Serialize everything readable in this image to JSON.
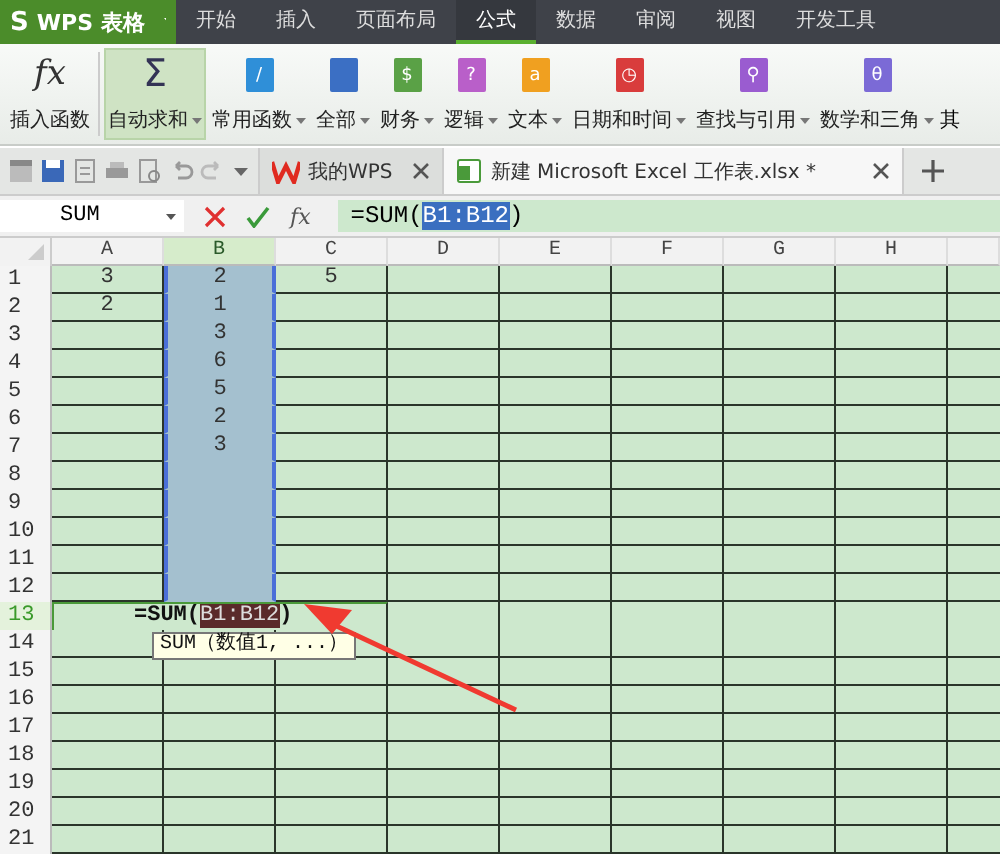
{
  "app_menu": {
    "label": "WPS 表格",
    "logo": "S"
  },
  "menu_tabs": [
    {
      "label": "开始",
      "selected": false
    },
    {
      "label": "插入",
      "selected": false
    },
    {
      "label": "页面布局",
      "selected": false
    },
    {
      "label": "公式",
      "selected": true
    },
    {
      "label": "数据",
      "selected": false
    },
    {
      "label": "审阅",
      "selected": false
    },
    {
      "label": "视图",
      "selected": false
    },
    {
      "label": "开发工具",
      "selected": false
    }
  ],
  "ribbon": [
    {
      "label": "插入函数",
      "kind": "fx",
      "glyph": "fx",
      "dropdown": false,
      "selected": false
    },
    {
      "label": "自动求和",
      "kind": "sigma",
      "glyph": "Σ",
      "dropdown": true,
      "selected": true
    },
    {
      "label": "常用函数",
      "kind": "book",
      "glyph": "/",
      "color": "#2f8fd8",
      "dropdown": true,
      "selected": false
    },
    {
      "label": "全部",
      "kind": "book",
      "color": "#3b6fc4",
      "dropdown": true,
      "selected": false
    },
    {
      "label": "财务",
      "kind": "book",
      "glyph": "$",
      "color": "#5aa146",
      "dropdown": true,
      "selected": false
    },
    {
      "label": "逻辑",
      "kind": "book",
      "glyph": "?",
      "color": "#b95fc9",
      "dropdown": true,
      "selected": false
    },
    {
      "label": "文本",
      "kind": "book",
      "glyph": "a",
      "color": "#f0a020",
      "dropdown": true,
      "selected": false
    },
    {
      "label": "日期和时间",
      "kind": "book",
      "glyph": "◷",
      "color": "#d93c3c",
      "dropdown": true,
      "selected": false
    },
    {
      "label": "查找与引用",
      "kind": "book",
      "glyph": "⚲",
      "color": "#9a5cd0",
      "dropdown": true,
      "selected": false
    },
    {
      "label": "数学和三角",
      "kind": "book",
      "glyph": "θ",
      "color": "#7b6ad6",
      "dropdown": true,
      "selected": false
    },
    {
      "label": "其",
      "kind": "text"
    }
  ],
  "doc_tabs": [
    {
      "label": "我的WPS",
      "kind": "wps",
      "selected": false
    },
    {
      "label": "新建 Microsoft Excel 工作表.xlsx *",
      "kind": "sheet",
      "selected": true
    }
  ],
  "formula_bar": {
    "name_box": "SUM",
    "fx": "fx",
    "formula": "=SUM(",
    "reference": "B1:B12",
    "closing": ")"
  },
  "columns": [
    {
      "label": "A",
      "selected": false
    },
    {
      "label": "B",
      "selected": true
    },
    {
      "label": "C",
      "selected": false
    },
    {
      "label": "D",
      "selected": false
    },
    {
      "label": "E",
      "selected": false
    },
    {
      "label": "F",
      "selected": false
    },
    {
      "label": "G",
      "selected": false
    },
    {
      "label": "H",
      "selected": false
    }
  ],
  "rows": [
    {
      "label": "1",
      "selected": false,
      "in_range": true,
      "cells": [
        "3",
        "2",
        "5"
      ]
    },
    {
      "label": "2",
      "selected": false,
      "in_range": true,
      "cells": [
        "2",
        "1"
      ]
    },
    {
      "label": "3",
      "selected": false,
      "in_range": true,
      "cells": [
        null,
        "3"
      ]
    },
    {
      "label": "4",
      "selected": false,
      "in_range": true,
      "cells": [
        null,
        "6"
      ]
    },
    {
      "label": "5",
      "selected": false,
      "in_range": true,
      "cells": [
        null,
        "5"
      ]
    },
    {
      "label": "6",
      "selected": false,
      "in_range": true,
      "cells": [
        null,
        "2"
      ]
    },
    {
      "label": "7",
      "selected": false,
      "in_range": true,
      "cells": [
        null,
        "3"
      ]
    },
    {
      "label": "8",
      "selected": false,
      "in_range": true
    },
    {
      "label": "9",
      "selected": false,
      "in_range": true
    },
    {
      "label": "10",
      "selected": false,
      "in_range": true
    },
    {
      "label": "11",
      "selected": false,
      "in_range": true
    },
    {
      "label": "12",
      "selected": false,
      "in_range": true
    },
    {
      "label": "13",
      "selected": true,
      "editing": {
        "formula": "=SUM(",
        "reference": "B1:B12",
        "closing": ")",
        "tooltip": "SUM（数值1, ...）"
      }
    },
    {
      "label": "14",
      "selected": false
    },
    {
      "label": "15",
      "selected": false
    },
    {
      "label": "16",
      "selected": false
    },
    {
      "label": "17",
      "selected": false
    },
    {
      "label": "18",
      "selected": false
    },
    {
      "label": "19",
      "selected": false
    },
    {
      "label": "20",
      "selected": false
    },
    {
      "label": "21",
      "selected": false
    }
  ]
}
